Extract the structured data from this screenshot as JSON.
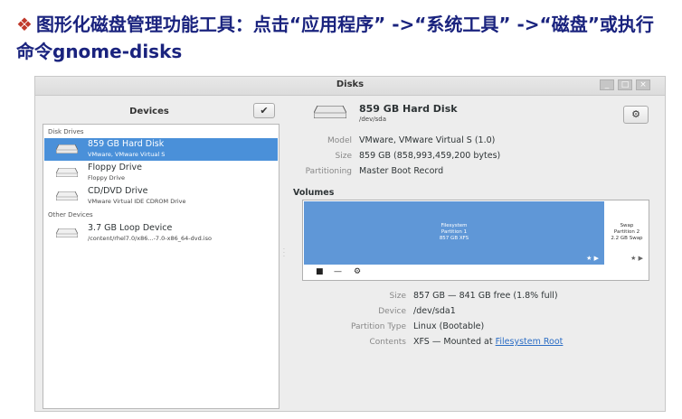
{
  "slide": {
    "bullet": "❖",
    "title": "图形化磁盘管理功能工具：点击“应用程序” ->“系统工具” ->“磁盘”或执行命令gnome-disks"
  },
  "window": {
    "title": "Disks",
    "controls": [
      "_",
      "□",
      "×"
    ]
  },
  "sidebar": {
    "title": "Devices",
    "check_button": "✔",
    "groups": [
      {
        "label": "Disk Drives"
      },
      {
        "label": "Other Devices"
      }
    ],
    "drives": [
      {
        "name": "859 GB Hard Disk",
        "sub": "VMware, VMware Virtual S",
        "selected": true
      },
      {
        "name": "Floppy Drive",
        "sub": "Floppy Drive",
        "selected": false
      },
      {
        "name": "CD/DVD Drive",
        "sub": "VMware Virtual IDE CDROM Drive",
        "selected": false
      },
      {
        "name": "3.7 GB Loop Device",
        "sub": "/content/rhel7.0/x86...-7.0-x86_64-dvd.iso",
        "selected": false
      }
    ]
  },
  "disk": {
    "name": "859 GB Hard Disk",
    "path": "/dev/sda",
    "gear_icon": "⚙",
    "props": [
      {
        "label": "Model",
        "value": "VMware, VMware Virtual S (1.0)"
      },
      {
        "label": "Size",
        "value": "859 GB (858,993,459,200 bytes)"
      },
      {
        "label": "Partitioning",
        "value": "Master Boot Record"
      }
    ]
  },
  "volumes": {
    "title": "Volumes",
    "partitions": [
      {
        "lines": [
          "Filesystem",
          "Partition 1",
          "857 GB XFS"
        ],
        "marks": "★ ▶"
      },
      {
        "lines": [
          "Swap",
          "Partition 2",
          "2.2 GB Swap"
        ],
        "marks": "★ ▶"
      }
    ],
    "tools": [
      "■",
      "—",
      "⚙"
    ],
    "props": [
      {
        "label": "Size",
        "value": "857 GB — 841 GB free (1.8% full)"
      },
      {
        "label": "Device",
        "value": "/dev/sda1"
      },
      {
        "label": "Partition Type",
        "value": "Linux (Bootable)"
      }
    ],
    "contents": {
      "label": "Contents",
      "value": "XFS — Mounted at ",
      "link": "Filesystem Root"
    }
  },
  "colors": {
    "selection": "#4a90d9",
    "partition": "#5f97d7",
    "title": "#1a237e"
  }
}
